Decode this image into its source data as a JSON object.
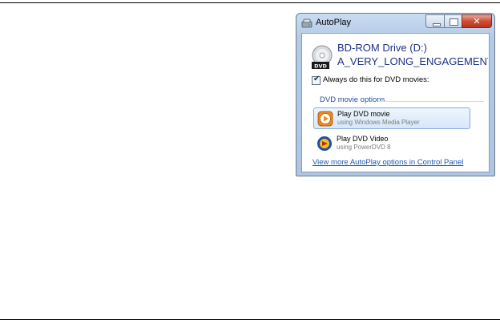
{
  "window": {
    "title": "AutoPlay",
    "icon": "autoplay-icon",
    "controls": [
      "minimize",
      "maximize",
      "close"
    ]
  },
  "drive": {
    "name": "BD-ROM Drive (D:)",
    "disc_label": "A_VERY_LONG_ENGAGEMENT_DISC",
    "icon": "dvd-drive-icon",
    "icon_badge": "DVD"
  },
  "always_checkbox": {
    "label": "Always do this for DVD movies:",
    "checked": true
  },
  "section": {
    "title": "DVD movie options"
  },
  "options": [
    {
      "title": "Play DVD movie",
      "subtitle": "using Windows Media Player",
      "icon": "windows-media-player-icon",
      "highlighted": true
    },
    {
      "title": "Play DVD Video",
      "subtitle": "using PowerDVD 8",
      "icon": "powerdvd-icon",
      "highlighted": false
    }
  ],
  "more_link": "View more AutoPlay options in Control Panel",
  "colors": {
    "accent_text": "#1e3287",
    "link": "#1c58b4",
    "highlight": "#d6e7fa",
    "close_button": "#cf4d35"
  }
}
